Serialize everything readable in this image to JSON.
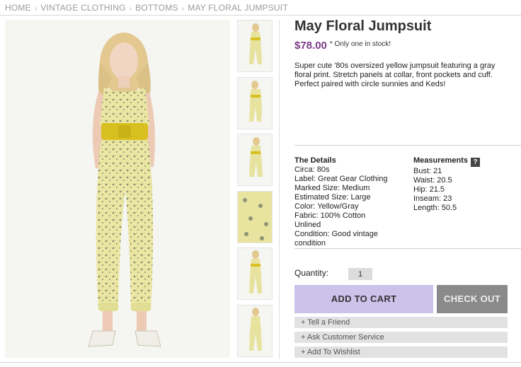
{
  "breadcrumb": {
    "items": [
      "HOME",
      "VINTAGE CLOTHING",
      "BOTTOMS",
      "MAY FLORAL JUMPSUIT"
    ]
  },
  "product": {
    "title": "May Floral Jumpsuit",
    "price": "$78.00",
    "stock_note": "* Only one in stock!",
    "description": "Super cute '80s oversized yellow jumpsuit featuring a gray floral print. Stretch panels at collar, front pockets and cuff. Perfect paired with circle sunnies and Keds!"
  },
  "details": {
    "heading": "The Details",
    "lines": [
      "Circa: 80s",
      "Label: Great Gear Clothing",
      "Marked Size: Medium",
      "Estimated Size: Large",
      "Color: Yellow/Gray",
      "Fabric: 100% Cotton",
      "Unlined",
      "Condition: Good vintage condition"
    ]
  },
  "measurements": {
    "heading": "Measurements",
    "help_icon": "?",
    "lines": [
      "Bust: 21",
      "Waist: 20.5",
      "Hip: 21.5",
      "Inseam: 23",
      "Length: 50.5"
    ]
  },
  "purchase": {
    "quantity_label": "Quantity:",
    "quantity_value": "1",
    "add_to_cart": "ADD TO CART",
    "check_out": "CHECK OUT"
  },
  "links": {
    "tell_friend": "+ Tell a Friend",
    "ask_service": "+ Ask Customer Service",
    "wishlist": "+ Add To Wishlist"
  },
  "colors": {
    "price": "#7d3c88",
    "add_to_cart_bg": "#ccc2ea",
    "check_out_bg": "#8a8a8a",
    "jumpsuit": "#ece8a4",
    "belt": "#d9c21f"
  }
}
